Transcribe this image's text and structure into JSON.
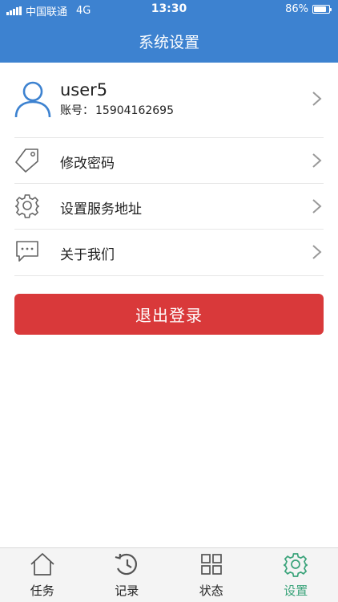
{
  "status_bar": {
    "carrier": "中国联通",
    "network": "4G",
    "time": "13:30",
    "battery": "86%",
    "battery_level": 0.86
  },
  "header": {
    "title": "系统设置"
  },
  "profile": {
    "username": "user5",
    "account_label": "账号：",
    "account_number": "15904162695",
    "icon": "user-avatar-icon"
  },
  "menu": [
    {
      "label": "修改密码",
      "icon": "tag-icon"
    },
    {
      "label": "设置服务地址",
      "icon": "gear-icon"
    },
    {
      "label": "关于我们",
      "icon": "chat-bubble-icon"
    }
  ],
  "logout_label": "退出登录",
  "tabs": [
    {
      "label": "任务",
      "icon": "home-icon",
      "active": false
    },
    {
      "label": "记录",
      "icon": "history-icon",
      "active": false
    },
    {
      "label": "状态",
      "icon": "grid-icon",
      "active": false
    },
    {
      "label": "设置",
      "icon": "gear-icon",
      "active": true
    }
  ],
  "colors": {
    "header": "#3d82d0",
    "logout": "#d9393a",
    "active_tab": "#3aa37a",
    "avatar": "#3d82d0"
  }
}
